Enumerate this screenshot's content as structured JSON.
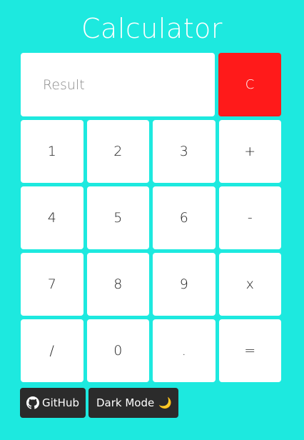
{
  "header": {
    "title": "Calculator"
  },
  "display": {
    "placeholder": "Result",
    "value": ""
  },
  "keys": {
    "clear": "C",
    "rows": [
      [
        "1",
        "2",
        "3",
        "+"
      ],
      [
        "4",
        "5",
        "6",
        "-"
      ],
      [
        "7",
        "8",
        "9",
        "x"
      ],
      [
        "/",
        "0",
        ".",
        "="
      ]
    ]
  },
  "footer": {
    "github_label": "GitHub",
    "github_icon": "github-icon",
    "dark_mode_label": "Dark Mode",
    "dark_mode_icon": "🌙"
  },
  "colors": {
    "background": "#1de9df",
    "clear_button": "#ff1a1a",
    "footer_button": "#2b2b2b"
  }
}
